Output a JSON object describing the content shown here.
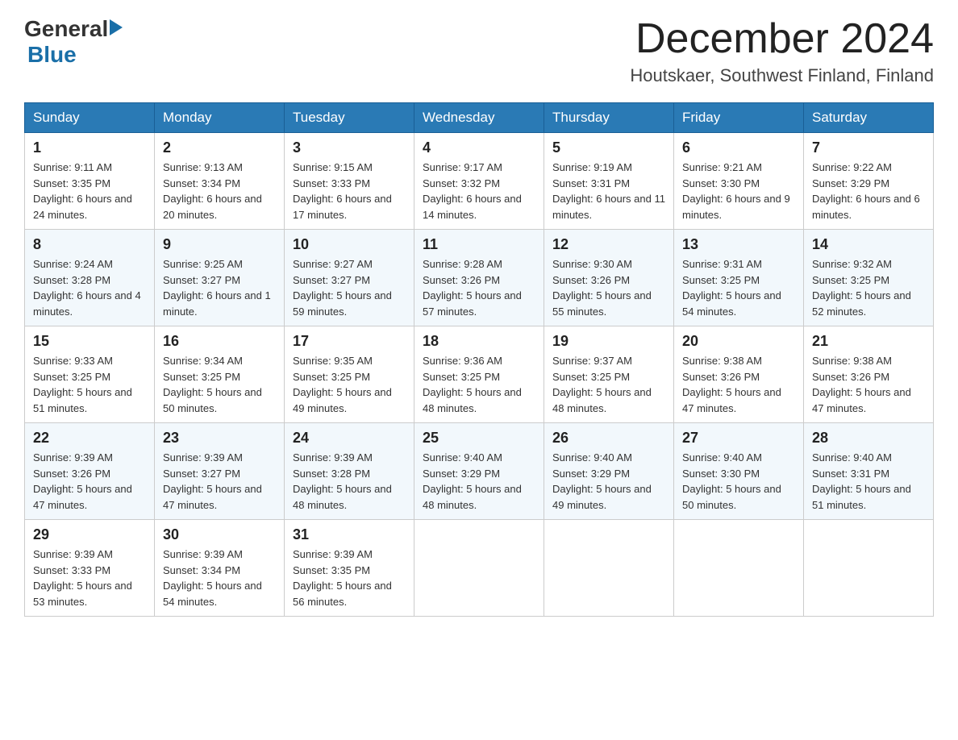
{
  "header": {
    "logo_general": "General",
    "logo_blue": "Blue",
    "month_title": "December 2024",
    "location": "Houtskaer, Southwest Finland, Finland"
  },
  "days_of_week": [
    "Sunday",
    "Monday",
    "Tuesday",
    "Wednesday",
    "Thursday",
    "Friday",
    "Saturday"
  ],
  "weeks": [
    [
      {
        "day": "1",
        "sunrise": "Sunrise: 9:11 AM",
        "sunset": "Sunset: 3:35 PM",
        "daylight": "Daylight: 6 hours and 24 minutes."
      },
      {
        "day": "2",
        "sunrise": "Sunrise: 9:13 AM",
        "sunset": "Sunset: 3:34 PM",
        "daylight": "Daylight: 6 hours and 20 minutes."
      },
      {
        "day": "3",
        "sunrise": "Sunrise: 9:15 AM",
        "sunset": "Sunset: 3:33 PM",
        "daylight": "Daylight: 6 hours and 17 minutes."
      },
      {
        "day": "4",
        "sunrise": "Sunrise: 9:17 AM",
        "sunset": "Sunset: 3:32 PM",
        "daylight": "Daylight: 6 hours and 14 minutes."
      },
      {
        "day": "5",
        "sunrise": "Sunrise: 9:19 AM",
        "sunset": "Sunset: 3:31 PM",
        "daylight": "Daylight: 6 hours and 11 minutes."
      },
      {
        "day": "6",
        "sunrise": "Sunrise: 9:21 AM",
        "sunset": "Sunset: 3:30 PM",
        "daylight": "Daylight: 6 hours and 9 minutes."
      },
      {
        "day": "7",
        "sunrise": "Sunrise: 9:22 AM",
        "sunset": "Sunset: 3:29 PM",
        "daylight": "Daylight: 6 hours and 6 minutes."
      }
    ],
    [
      {
        "day": "8",
        "sunrise": "Sunrise: 9:24 AM",
        "sunset": "Sunset: 3:28 PM",
        "daylight": "Daylight: 6 hours and 4 minutes."
      },
      {
        "day": "9",
        "sunrise": "Sunrise: 9:25 AM",
        "sunset": "Sunset: 3:27 PM",
        "daylight": "Daylight: 6 hours and 1 minute."
      },
      {
        "day": "10",
        "sunrise": "Sunrise: 9:27 AM",
        "sunset": "Sunset: 3:27 PM",
        "daylight": "Daylight: 5 hours and 59 minutes."
      },
      {
        "day": "11",
        "sunrise": "Sunrise: 9:28 AM",
        "sunset": "Sunset: 3:26 PM",
        "daylight": "Daylight: 5 hours and 57 minutes."
      },
      {
        "day": "12",
        "sunrise": "Sunrise: 9:30 AM",
        "sunset": "Sunset: 3:26 PM",
        "daylight": "Daylight: 5 hours and 55 minutes."
      },
      {
        "day": "13",
        "sunrise": "Sunrise: 9:31 AM",
        "sunset": "Sunset: 3:25 PM",
        "daylight": "Daylight: 5 hours and 54 minutes."
      },
      {
        "day": "14",
        "sunrise": "Sunrise: 9:32 AM",
        "sunset": "Sunset: 3:25 PM",
        "daylight": "Daylight: 5 hours and 52 minutes."
      }
    ],
    [
      {
        "day": "15",
        "sunrise": "Sunrise: 9:33 AM",
        "sunset": "Sunset: 3:25 PM",
        "daylight": "Daylight: 5 hours and 51 minutes."
      },
      {
        "day": "16",
        "sunrise": "Sunrise: 9:34 AM",
        "sunset": "Sunset: 3:25 PM",
        "daylight": "Daylight: 5 hours and 50 minutes."
      },
      {
        "day": "17",
        "sunrise": "Sunrise: 9:35 AM",
        "sunset": "Sunset: 3:25 PM",
        "daylight": "Daylight: 5 hours and 49 minutes."
      },
      {
        "day": "18",
        "sunrise": "Sunrise: 9:36 AM",
        "sunset": "Sunset: 3:25 PM",
        "daylight": "Daylight: 5 hours and 48 minutes."
      },
      {
        "day": "19",
        "sunrise": "Sunrise: 9:37 AM",
        "sunset": "Sunset: 3:25 PM",
        "daylight": "Daylight: 5 hours and 48 minutes."
      },
      {
        "day": "20",
        "sunrise": "Sunrise: 9:38 AM",
        "sunset": "Sunset: 3:26 PM",
        "daylight": "Daylight: 5 hours and 47 minutes."
      },
      {
        "day": "21",
        "sunrise": "Sunrise: 9:38 AM",
        "sunset": "Sunset: 3:26 PM",
        "daylight": "Daylight: 5 hours and 47 minutes."
      }
    ],
    [
      {
        "day": "22",
        "sunrise": "Sunrise: 9:39 AM",
        "sunset": "Sunset: 3:26 PM",
        "daylight": "Daylight: 5 hours and 47 minutes."
      },
      {
        "day": "23",
        "sunrise": "Sunrise: 9:39 AM",
        "sunset": "Sunset: 3:27 PM",
        "daylight": "Daylight: 5 hours and 47 minutes."
      },
      {
        "day": "24",
        "sunrise": "Sunrise: 9:39 AM",
        "sunset": "Sunset: 3:28 PM",
        "daylight": "Daylight: 5 hours and 48 minutes."
      },
      {
        "day": "25",
        "sunrise": "Sunrise: 9:40 AM",
        "sunset": "Sunset: 3:29 PM",
        "daylight": "Daylight: 5 hours and 48 minutes."
      },
      {
        "day": "26",
        "sunrise": "Sunrise: 9:40 AM",
        "sunset": "Sunset: 3:29 PM",
        "daylight": "Daylight: 5 hours and 49 minutes."
      },
      {
        "day": "27",
        "sunrise": "Sunrise: 9:40 AM",
        "sunset": "Sunset: 3:30 PM",
        "daylight": "Daylight: 5 hours and 50 minutes."
      },
      {
        "day": "28",
        "sunrise": "Sunrise: 9:40 AM",
        "sunset": "Sunset: 3:31 PM",
        "daylight": "Daylight: 5 hours and 51 minutes."
      }
    ],
    [
      {
        "day": "29",
        "sunrise": "Sunrise: 9:39 AM",
        "sunset": "Sunset: 3:33 PM",
        "daylight": "Daylight: 5 hours and 53 minutes."
      },
      {
        "day": "30",
        "sunrise": "Sunrise: 9:39 AM",
        "sunset": "Sunset: 3:34 PM",
        "daylight": "Daylight: 5 hours and 54 minutes."
      },
      {
        "day": "31",
        "sunrise": "Sunrise: 9:39 AM",
        "sunset": "Sunset: 3:35 PM",
        "daylight": "Daylight: 5 hours and 56 minutes."
      },
      null,
      null,
      null,
      null
    ]
  ]
}
